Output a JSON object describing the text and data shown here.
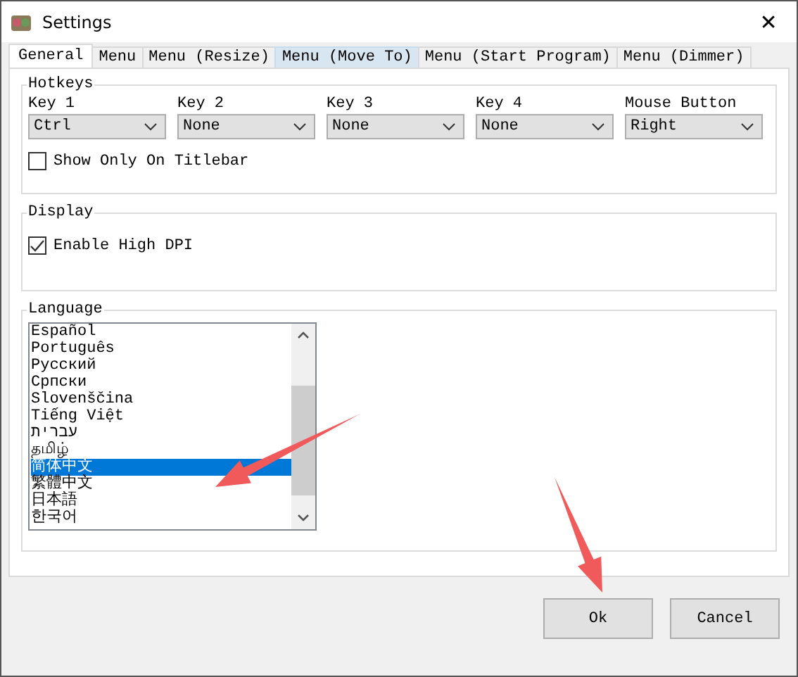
{
  "window": {
    "title": "Settings",
    "close": "✕"
  },
  "tabs": [
    {
      "label": "General",
      "selected": true,
      "hovered": false
    },
    {
      "label": "Menu",
      "selected": false,
      "hovered": false
    },
    {
      "label": "Menu (Resize)",
      "selected": false,
      "hovered": false
    },
    {
      "label": "Menu (Move To)",
      "selected": false,
      "hovered": true
    },
    {
      "label": "Menu (Start Program)",
      "selected": false,
      "hovered": false
    },
    {
      "label": "Menu (Dimmer)",
      "selected": false,
      "hovered": false
    }
  ],
  "hotkeys": {
    "title": "Hotkeys",
    "keys": [
      {
        "label": "Key 1",
        "value": "Ctrl"
      },
      {
        "label": "Key 2",
        "value": "None"
      },
      {
        "label": "Key 3",
        "value": "None"
      },
      {
        "label": "Key 4",
        "value": "None"
      },
      {
        "label": "Mouse Button",
        "value": "Right"
      }
    ],
    "titlebar_only": {
      "label": "Show Only On Titlebar",
      "checked": false
    }
  },
  "display": {
    "title": "Display",
    "high_dpi": {
      "label": "Enable High DPI",
      "checked": true
    }
  },
  "language": {
    "title": "Language",
    "items": [
      {
        "label": "Español",
        "selected": false
      },
      {
        "label": "Português",
        "selected": false
      },
      {
        "label": "Русский",
        "selected": false
      },
      {
        "label": "Српски",
        "selected": false
      },
      {
        "label": "Slovenščina",
        "selected": false
      },
      {
        "label": "Tiếng Việt",
        "selected": false
      },
      {
        "label": "עברית",
        "selected": false
      },
      {
        "label": "தமிழ்",
        "selected": false
      },
      {
        "label": "简体中文",
        "selected": true
      },
      {
        "label": "繁體中文",
        "selected": false
      },
      {
        "label": "日本語",
        "selected": false
      },
      {
        "label": "한국어",
        "selected": false
      }
    ]
  },
  "buttons": [
    "Ok",
    "Cancel"
  ]
}
